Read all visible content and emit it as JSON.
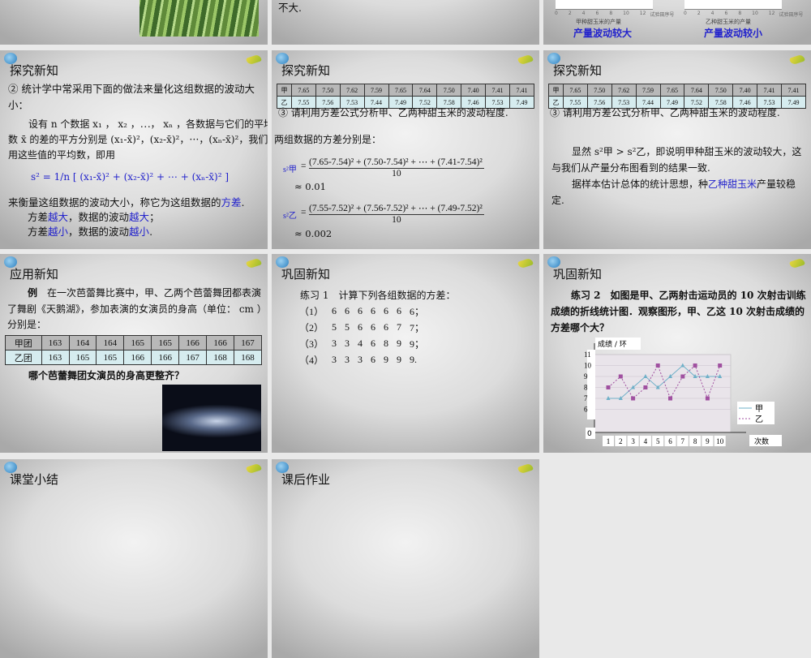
{
  "slides": [
    {
      "id": "s0a",
      "partial": true
    },
    {
      "id": "s0b",
      "text": "不大."
    },
    {
      "id": "s0c",
      "captions": [
        "甲种甜玉米的产量",
        "乙种甜玉米的产量"
      ],
      "conclusions": [
        "产量波动较大",
        "产量波动较小"
      ],
      "axis_ticks": [
        "0",
        "2",
        "4",
        "6",
        "8",
        "10",
        "12"
      ],
      "axis_label": "试验田序号"
    },
    {
      "id": "s1",
      "title": "探究新知",
      "p1": "② 统计学中常采用下面的做法来量化这组数据的波动大小：",
      "p2": "设有 n 个数据 x₁ ， x₂ ，⋯， xₙ ，各数据与它们的平均数 x̄ 的差的平方分别是 (x₁-x̄)²，(x₂-x̄)²，⋯，(xₙ-x̄)²，我们用这些值的平均数，即用",
      "formula": "s² = 1/n [ (x₁-x̄)² + (x₂-x̄)² + ⋯ + (xₙ-x̄)² ]",
      "p3a": "来衡量这组数据的波动大小，称它为这组数据的",
      "p3b": "方差",
      "p3c": ".",
      "l1": [
        "方差",
        "越大",
        "，数据的波动",
        "越大",
        "；"
      ],
      "l2": [
        "方差",
        "越小",
        "，数据的波动",
        "越小",
        "."
      ]
    },
    {
      "id": "s2",
      "title": "探究新知",
      "table": [
        [
          "甲",
          "7.65",
          "7.50",
          "7.62",
          "7.59",
          "7.65",
          "7.64",
          "7.50",
          "7.40",
          "7.41",
          "7.41"
        ],
        [
          "乙",
          "7.55",
          "7.56",
          "7.53",
          "7.44",
          "7.49",
          "7.52",
          "7.58",
          "7.46",
          "7.53",
          "7.49"
        ]
      ],
      "q": "③ 请利用方差公式分析甲、乙两种甜玉米的波动程度.",
      "intro": "两组数据的方差分别是：",
      "s_jia": "s²甲",
      "num_jia": "(7.65-7.54)² + (7.50-7.54)² + ⋯ + (7.41-7.54)²",
      "den": "10",
      "res_jia": "≈ 0.01",
      "s_yi": "s²乙",
      "num_yi": "(7.55-7.52)² + (7.56-7.52)² + ⋯ + (7.49-7.52)²",
      "res_yi": "≈ 0.002"
    },
    {
      "id": "s3",
      "title": "探究新知",
      "q": "③ 请利用方差公式分析甲、乙两种甜玉米的波动程度.",
      "p1": "显然 s²甲 > s²乙，即说明甲种甜玉米的波动较大，这与我们从产量分布图看到的结果一致.",
      "p2a": "据样本估计总体的统计思想，种",
      "p2b": "乙种甜玉米",
      "p2c": "产量较稳定."
    },
    {
      "id": "s4",
      "title": "应用新知",
      "p_lead": "例",
      "p1": "在一次芭蕾舞比赛中，甲、乙两个芭蕾舞团都表演了舞剧《天鹅湖》，参加表演的女演员的身高（单位： cm ）分别是：",
      "table": [
        [
          "甲团",
          "163",
          "164",
          "164",
          "165",
          "165",
          "166",
          "166",
          "167"
        ],
        [
          "乙团",
          "163",
          "165",
          "165",
          "166",
          "166",
          "167",
          "168",
          "168"
        ]
      ],
      "q": "哪个芭蕾舞团女演员的身高更整齐？"
    },
    {
      "id": "s5",
      "title": "巩固新知",
      "p1": "练习 1　计算下列各组数据的方差：",
      "rows": [
        [
          "（1）",
          "6",
          "6",
          "6",
          "6",
          "6",
          "6",
          "6；"
        ],
        [
          "（2）",
          "5",
          "5",
          "6",
          "6",
          "6",
          "7",
          "7；"
        ],
        [
          "（3）",
          "3",
          "3",
          "4",
          "6",
          "8",
          "9",
          "9；"
        ],
        [
          "（4）",
          "3",
          "3",
          "3",
          "6",
          "9",
          "9",
          "9."
        ]
      ]
    },
    {
      "id": "s6",
      "title": "巩固新知",
      "p1": "练习 2　如图是甲、乙两射击运动员的 10 次射击训练成绩的折线统计图．观察图形，甲、乙这 10 次射击成绩的方差哪个大？"
    },
    {
      "id": "s7",
      "title": "课堂小结"
    },
    {
      "id": "s8",
      "title": "课后作业"
    }
  ],
  "chart_data": {
    "type": "line",
    "ylabel": "成绩 / 环",
    "xlabel": "次数",
    "x": [
      1,
      2,
      3,
      4,
      5,
      6,
      7,
      8,
      9,
      10
    ],
    "yticks": [
      "11",
      "10",
      "9",
      "8",
      "7",
      "6",
      "0"
    ],
    "series": [
      {
        "name": "甲",
        "values": [
          7,
          7,
          8,
          9,
          8,
          9,
          10,
          9,
          9,
          9
        ],
        "color": "#6fb0c8"
      },
      {
        "name": "乙",
        "values": [
          8,
          9,
          7,
          8,
          10,
          7,
          9,
          10,
          7,
          10
        ],
        "color": "#a050a0"
      }
    ]
  }
}
